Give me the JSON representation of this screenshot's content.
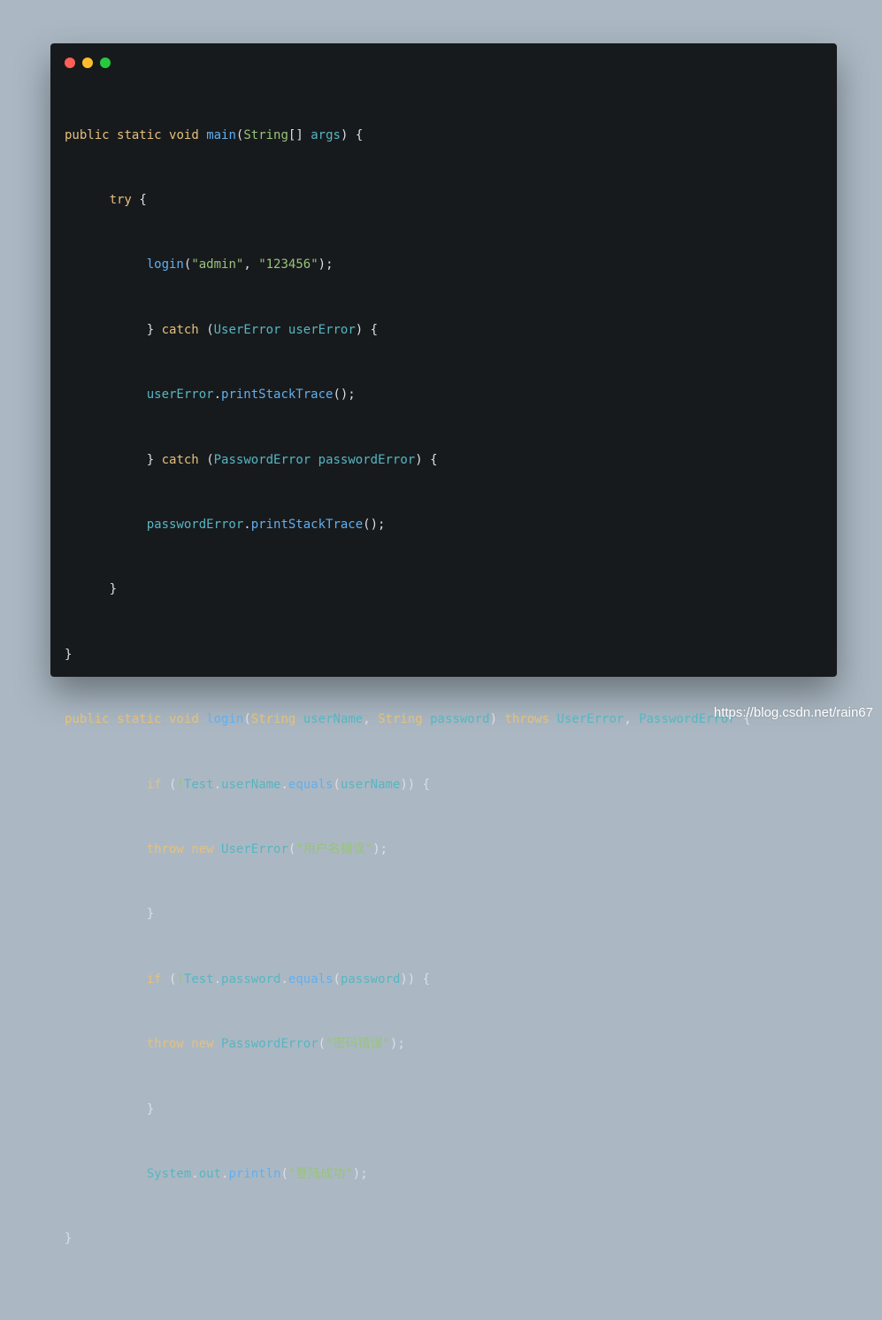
{
  "window": {
    "controls": {
      "close_color": "#ff5f56",
      "minimize_color": "#ffbd2e",
      "maximize_color": "#27c93f"
    }
  },
  "code": {
    "l1": {
      "public": "public",
      "static": "static",
      "void": "void",
      "name": "main",
      "open": "(",
      "type": "String",
      "arr": "[]",
      "arg": "args",
      "close": ")",
      "brace": "{"
    },
    "l2": {
      "kw": "try",
      "brace": "{"
    },
    "l3": {
      "fn": "login",
      "open": "(",
      "s1": "\"admin\"",
      "comma": ",",
      "s2": "\"123456\"",
      "close": ");"
    },
    "l4": {
      "brace": "}",
      "kw": "catch",
      "open": "(",
      "type": "UserError",
      "var": "userError",
      "close": ")",
      "brace2": "{"
    },
    "l5": {
      "obj": "userError",
      "dot": ".",
      "method": "printStackTrace",
      "call": "();"
    },
    "l6": {
      "brace": "}",
      "kw": "catch",
      "open": "(",
      "type": "PasswordError",
      "var": "passwordError",
      "close": ")",
      "brace2": "{"
    },
    "l7": {
      "obj": "passwordError",
      "dot": ".",
      "method": "printStackTrace",
      "call": "();"
    },
    "l8": {
      "brace": "}"
    },
    "l9": {
      "brace": "}"
    },
    "l10": {
      "public": "public",
      "static": "static",
      "void": "void",
      "name": "login",
      "open": "(",
      "t1": "String",
      "v1": "userName",
      "comma": ",",
      "t2": "String",
      "v2": "password",
      "close": ")",
      "throws": "throws",
      "e1": "UserError",
      "comma2": ",",
      "e2": "PasswordError",
      "brace": "{"
    },
    "l11": {
      "kw": "if",
      "open": "(",
      "not": "!",
      "cls": "Test",
      "dot1": ".",
      "field": "userName",
      "dot2": ".",
      "method": "equals",
      "open2": "(",
      "arg": "userName",
      "close": "))",
      "brace": "{"
    },
    "l12": {
      "kw1": "throw",
      "kw2": "new",
      "type": "UserError",
      "open": "(",
      "str": "\"用户名错误\"",
      "close": ");"
    },
    "l13": {
      "brace": "}"
    },
    "l14": {
      "kw": "if",
      "open": "(",
      "not": "!",
      "cls": "Test",
      "dot1": ".",
      "field": "password",
      "dot2": ".",
      "method": "equals",
      "open2": "(",
      "arg": "password",
      "close": "))",
      "brace": "{"
    },
    "l15": {
      "kw1": "throw",
      "kw2": "new",
      "type": "PasswordError",
      "open": "(",
      "str": "\"密码错误\"",
      "close": ");"
    },
    "l16": {
      "brace": "}"
    },
    "l17": {
      "cls": "System",
      "dot1": ".",
      "field": "out",
      "dot2": ".",
      "method": "println",
      "open": "(",
      "str": "\"登陆成功\"",
      "close": ");"
    },
    "l18": {
      "brace": "}"
    }
  },
  "watermark": "https://blog.csdn.net/rain67"
}
